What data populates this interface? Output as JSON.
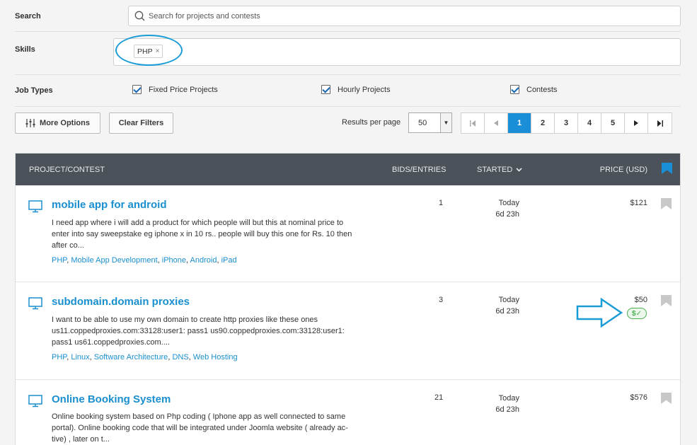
{
  "filters": {
    "search_label": "Search",
    "search_placeholder": "Search for projects and contests",
    "skills_label": "Skills",
    "skill_tags": [
      {
        "label": "PHP",
        "remove": "×"
      }
    ],
    "job_types_label": "Job Types",
    "job_types": [
      {
        "label": "Fixed Price Projects",
        "checked": true
      },
      {
        "label": "Hourly Projects",
        "checked": true
      },
      {
        "label": "Contests",
        "checked": true
      }
    ]
  },
  "toolbar": {
    "more_options_label": "More Options",
    "clear_filters_label": "Clear Filters",
    "results_per_page_label": "Results per page",
    "results_per_page_value": "50",
    "pages": [
      "1",
      "2",
      "3",
      "4",
      "5"
    ],
    "current_page": "1"
  },
  "table": {
    "headers": {
      "project": "PROJECT/CONTEST",
      "bids": "BIDS/ENTRIES",
      "started": "STARTED",
      "price": "PRICE (USD)"
    },
    "rows": [
      {
        "title": "mobile app for android",
        "description": "I need app where i will add a product for which people will but this at nominal price to enter into say sweepstake eg iphone x in 10 rs.. people will buy this one for Rs. 10 then after co...",
        "skills": [
          "PHP",
          "Mobile App Development",
          "iPhone",
          "Android",
          "iPad"
        ],
        "bids": "1",
        "started_day": "Today",
        "started_left": "6d 23h",
        "price": "$121",
        "verified": false
      },
      {
        "title": "subdomain.domain proxies",
        "description": "I want to be able to use my own domain to create http proxies like these ones us11.coppedproxies.com:33128:user1: pass1 us90.coppedproxies.com:33128:user1: pass1 us61.coppedproxies.com....",
        "skills": [
          "PHP",
          "Linux",
          "Software Architecture",
          "DNS",
          "Web Hosting"
        ],
        "bids": "3",
        "started_day": "Today",
        "started_left": "6d 23h",
        "price": "$50",
        "verified": true,
        "verified_label": "$✓"
      },
      {
        "title": "Online Booking System",
        "description": "Online booking system based on Php coding ( Iphone app as well connected to same portal). Online booking code that will be integrated under Joomla website ( already ac- tive) , later on t...",
        "skills": [],
        "bids": "21",
        "started_day": "Today",
        "started_left": "6d 23h",
        "price": "$576",
        "verified": false
      }
    ]
  },
  "colors": {
    "accent": "#1a8fd8",
    "header_bg": "#4c5259",
    "annotation": "#1a9cd6",
    "verified": "#4caf50"
  }
}
